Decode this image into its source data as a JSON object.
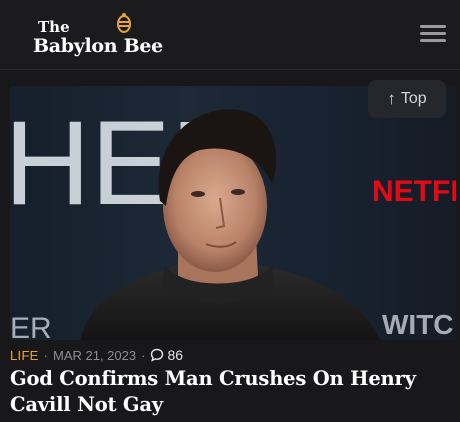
{
  "brand": {
    "line1": "The",
    "line2": "Babylon Bee",
    "accent_color": "#e7a338"
  },
  "header": {
    "menu_icon": "hamburger-menu-icon"
  },
  "hero": {
    "backdrop_letters_left": "HER",
    "backdrop_letters_bottom_left": "ER",
    "backdrop_logo_right": "NETFLI",
    "backdrop_logo_bottom_right": "WITC",
    "netflix_color": "#e50914"
  },
  "top_button": {
    "icon": "arrow-up-icon",
    "label": "Top"
  },
  "article": {
    "category": "LIFE",
    "separator": "·",
    "date": "MAR 21, 2023",
    "comment_icon": "comment-bubble-icon",
    "comment_count": "86",
    "title": "God Confirms Man Crushes On Henry Cavill Not Gay"
  }
}
